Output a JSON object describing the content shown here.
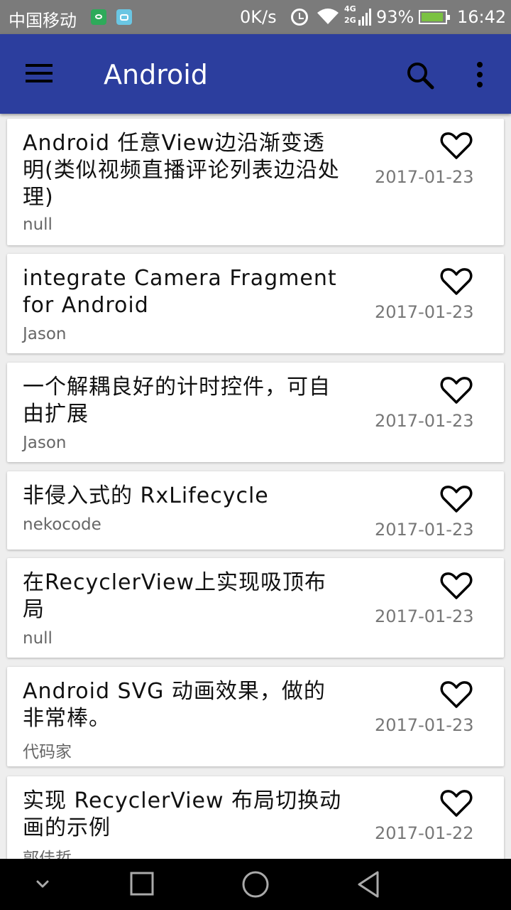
{
  "status_bar": {
    "carrier": "中国移动",
    "net_speed": "0K/s",
    "network_types": [
      "4G",
      "2G"
    ],
    "battery_percent": "93%",
    "time": "16:42",
    "colors": {
      "bar": "#7b7b7b",
      "battery_fill": "#7bc242"
    }
  },
  "app_bar": {
    "title": "Android",
    "icons": [
      "menu-icon",
      "search-icon",
      "more-vert-icon"
    ],
    "color": "#2c3e9e"
  },
  "articles": [
    {
      "title": "Android 任意View边沿渐变透明(类似视频直播评论列表边沿处理)",
      "author": "null",
      "date": "2017-01-23"
    },
    {
      "title": "integrate Camera Fragment for Android",
      "author": "Jason",
      "date": "2017-01-23"
    },
    {
      "title": "一个解耦良好的计时控件，可自由扩展",
      "author": "Jason",
      "date": "2017-01-23"
    },
    {
      "title": "非侵入式的 RxLifecycle",
      "author": "nekocode",
      "date": "2017-01-23"
    },
    {
      "title": "在RecyclerView上实现吸顶布局",
      "author": "null",
      "date": "2017-01-23"
    },
    {
      "title": "Android SVG 动画效果，做的非常棒。",
      "author": "代码家",
      "date": "2017-01-23"
    },
    {
      "title": "实现 RecyclerView 布局切换动画的示例",
      "author": "郭佳哲",
      "date": "2017-01-22"
    }
  ],
  "nav_bar": {
    "icons": [
      "chevron-down-icon",
      "recents-icon",
      "home-icon",
      "back-icon"
    ]
  }
}
